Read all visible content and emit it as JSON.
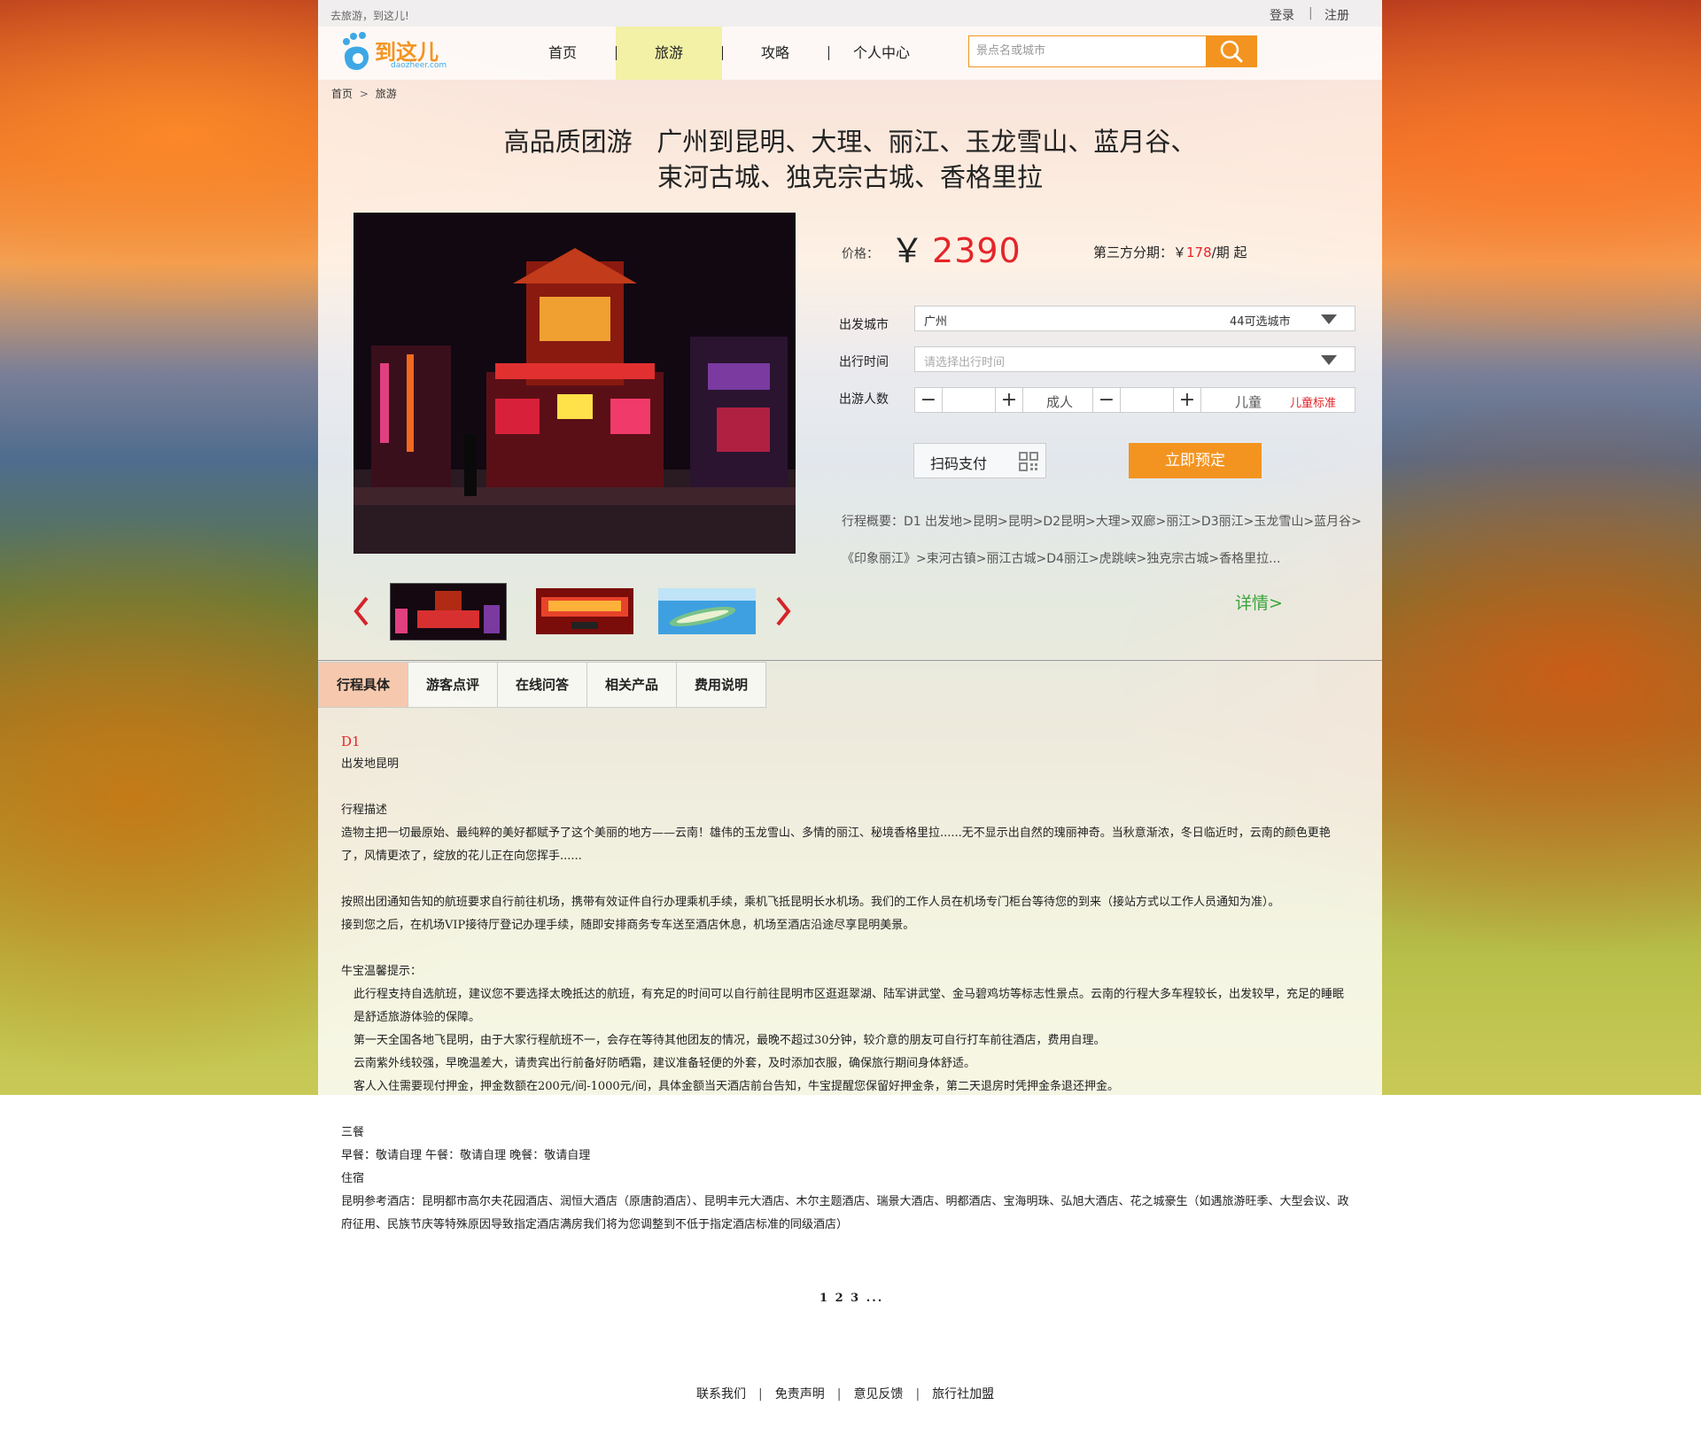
{
  "topbar": {
    "slogan": "去旅游，到这儿!",
    "login": "登录",
    "separator": "|",
    "register": "注册"
  },
  "logo": {
    "text": "到这儿",
    "subtext": "daozheer.com"
  },
  "nav": {
    "items": [
      "首页",
      "旅游",
      "攻略",
      "个人中心"
    ],
    "active": "旅游"
  },
  "search": {
    "placeholder": "景点名或城市",
    "icon": "search-icon"
  },
  "breadcrumb": {
    "home": "首页",
    "arrow": ">",
    "current": "旅游"
  },
  "product": {
    "title_line1": "高品质团游   广州到昆明、大理、丽江、玉龙雪山、蓝月谷、",
    "title_line2": "束河古城、独克宗古城、香格里拉",
    "price_label": "价格：",
    "currency": "￥",
    "price": "2390",
    "installment_prefix": "第三方分期：￥",
    "installment_amount": "178",
    "installment_suffix": "/期 起"
  },
  "form": {
    "departure_label": "出发城市",
    "departure_value": "广州",
    "departure_extra": "44可选城市",
    "date_label": "出行时间",
    "date_placeholder": "请选择出行时间",
    "people_label": "出游人数",
    "adult_label": "成人",
    "child_label": "儿童",
    "child_standard": "儿童标准",
    "minus": "−",
    "plus": "+"
  },
  "actions": {
    "scan_pay": "扫码支付",
    "book_now": "立即预定",
    "details": "详情>"
  },
  "summary": {
    "line1": "行程概要：D1 出发地>昆明>昆明>D2昆明>大理>双廊>丽江>D3丽江>玉龙雪山>蓝月谷>",
    "line2": "《印象丽江》>束河古镇>丽江古城>D4丽江>虎跳峡>独克宗古城>香格里拉..."
  },
  "tabs": [
    "行程具体",
    "游客点评",
    "在线问答",
    "相关产品",
    "费用说明"
  ],
  "itinerary": {
    "day": "D1",
    "route": "出发地昆明",
    "desc_title": "行程描述",
    "desc": "造物主把一切最原始、最纯粹的美好都赋予了这个美丽的地方——云南！雄伟的玉龙雪山、多情的丽江、秘境香格里拉......无不显示出自然的瑰丽神奇。当秋意渐浓，冬日临近时，云南的颜色更艳了，风情更浓了，绽放的花儿正在向您挥手......",
    "flight": "按照出团通知告知的航班要求自行前往机场，携带有效证件自行办理乘机手续，乘机飞抵昆明长水机场。我们的工作人员在机场专门柜台等待您的到来（接站方式以工作人员通知为准）。",
    "pickup": "接到您之后，在机场VIP接待厅登记办理手续，随即安排商务专车送至酒店休息，机场至酒店沿途尽享昆明美景。",
    "tips_title": "牛宝温馨提示：",
    "tip1": "此行程支持自选航班，建议您不要选择太晚抵达的航班，有充足的时间可以自行前往昆明市区逛逛翠湖、陆军讲武堂、金马碧鸡坊等标志性景点。云南的行程大多车程较长，出发较早，充足的睡眠是舒适旅游体验的保障。",
    "tip2": "第一天全国各地飞昆明，由于大家行程航班不一，会存在等待其他团友的情况，最晚不超过30分钟，较介意的朋友可自行打车前往酒店，费用自理。",
    "tip3": "云南紫外线较强，早晚温差大，请贵宾出行前备好防晒霜，建议准备轻便的外套，及时添加衣服，确保旅行期间身体舒适。",
    "tip4": "客人入住需要现付押金，押金数额在200元/间-1000元/间，具体金额当天酒店前台告知，牛宝提醒您保留好押金条，第二天退房时凭押金条退还押金。",
    "meals_title": "三餐",
    "meals": "早餐：敬请自理 午餐：敬请自理 晚餐：敬请自理",
    "hotel_title": "住宿",
    "hotel": "昆明参考酒店：昆明都市高尔夫花园酒店、润恒大酒店（原唐韵酒店）、昆明丰元大酒店、木尔主题酒店、瑞景大酒店、明都酒店、宝海明珠、弘旭大酒店、花之城豪生（如遇旅游旺季、大型会议、政府征用、民族节庆等特殊原因导致指定酒店满房我们将为您调整到不低于指定酒店标准的同级酒店）"
  },
  "pagination": "1 2 3 ...",
  "footer": {
    "links": [
      "联系我们",
      "免责声明",
      "意见反馈",
      "旅行社加盟"
    ],
    "separator": "|"
  },
  "colors": {
    "accent": "#f39421",
    "price_red": "#e4252a",
    "nav_active": "#f3f1a6",
    "tab_active": "#f6c9ae",
    "detail_green": "#3aa53a"
  }
}
